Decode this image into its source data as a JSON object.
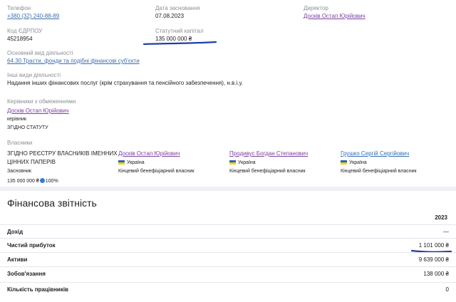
{
  "phone": {
    "label": "Телефон",
    "value": "+380 (32) 240-88-89"
  },
  "registration": {
    "label": "Дата засновання",
    "value": "07.08.2023"
  },
  "director": {
    "label": "Директор",
    "value": "Досків Остап Юрійович"
  },
  "edrpou": {
    "label": "Код ЄДРПОУ",
    "value": "45218954"
  },
  "capital": {
    "label": "Статутний капітал",
    "value": "135 000 000 ₴"
  },
  "main_activity": {
    "label": "Основний вид діяльності",
    "value": "64.30 Трасти, фонди та подібні фінансові суб'єкти"
  },
  "other_activity": {
    "label": "Інші види діяльності",
    "value": "Надання інших фінансових послуг (крім страхування та пенсійного забезпечення), н.в.і.у."
  },
  "managers": {
    "label": "Керівники з обмеженнями",
    "name": "Досків Остап Юрійович",
    "role": "керівник",
    "basis": "ЗГІДНО СТАТУТУ"
  },
  "owners": {
    "label": "Власники",
    "registry": {
      "line1": "ЗГІДНО РЕЄСТРУ ВЛАСНИКІВ ІМЕННИХ",
      "line2": "ЦІННИХ ПАПЕРІВ",
      "role": "Засновник",
      "amount": "135 000 000 ₴",
      "percent": "100%"
    },
    "beneficiaries": [
      {
        "name": "Досків Остап Юрійович",
        "country": "Україна",
        "role": "Кінцевий бенефіціарний власник"
      },
      {
        "name": "Продивус Богдан Степанович",
        "country": "Україна",
        "role": "Кінцевий бенефіціарний власник"
      },
      {
        "name": "Грушко Сергій Сергійович",
        "country": "Україна",
        "role": "Кінцевий бенефіціарний власник"
      }
    ]
  },
  "finance": {
    "title": "Фінансова звітність",
    "year": "2023",
    "rows": [
      {
        "name": "Дохід",
        "value": "—"
      },
      {
        "name": "Чистий прибуток",
        "value": "1 101 000 ₴"
      },
      {
        "name": "Активи",
        "value": "9 639 000 ₴"
      },
      {
        "name": "Зобов'язання",
        "value": "138 000 ₴"
      },
      {
        "name": "Кількість працівників",
        "value": "0"
      }
    ]
  },
  "colors": {
    "link": "#3a6fb0",
    "person_link": "#7b3f9e",
    "highlight_stroke": "#1f3fa8"
  }
}
